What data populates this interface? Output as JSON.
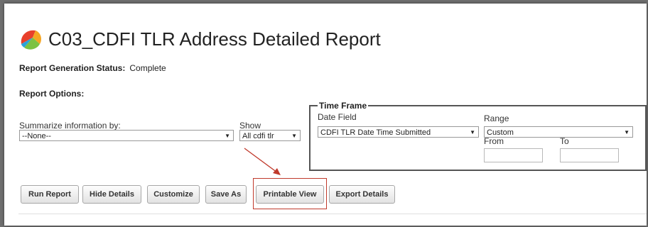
{
  "page": {
    "title": "C03_CDFI TLR Address Detailed Report"
  },
  "status": {
    "label": "Report Generation Status:",
    "value": "Complete"
  },
  "options": {
    "title": "Report Options:",
    "summarize_label": "Summarize information by:",
    "summarize_value": "--None--",
    "show_label": "Show",
    "show_value": "All cdfi tlr"
  },
  "timeframe": {
    "legend": "Time Frame",
    "date_field_label": "Date Field",
    "date_field_value": "CDFI TLR Date Time Submitted",
    "range_label": "Range",
    "range_value": "Custom",
    "from_label": "From",
    "to_label": "To",
    "from_value": "",
    "to_value": ""
  },
  "buttons": {
    "run_report": "Run Report",
    "hide_details": "Hide Details",
    "customize": "Customize",
    "save_as": "Save As",
    "printable_view": "Printable View",
    "export_details": "Export Details"
  },
  "colors": {
    "annotation": "#c0392b",
    "logo_colors": [
      "#e8402b",
      "#f5a623",
      "#7cc242",
      "#2aa3dc"
    ]
  },
  "icons": {
    "logo": "report-logo-icon",
    "dropdown": "chevron-down-icon"
  }
}
